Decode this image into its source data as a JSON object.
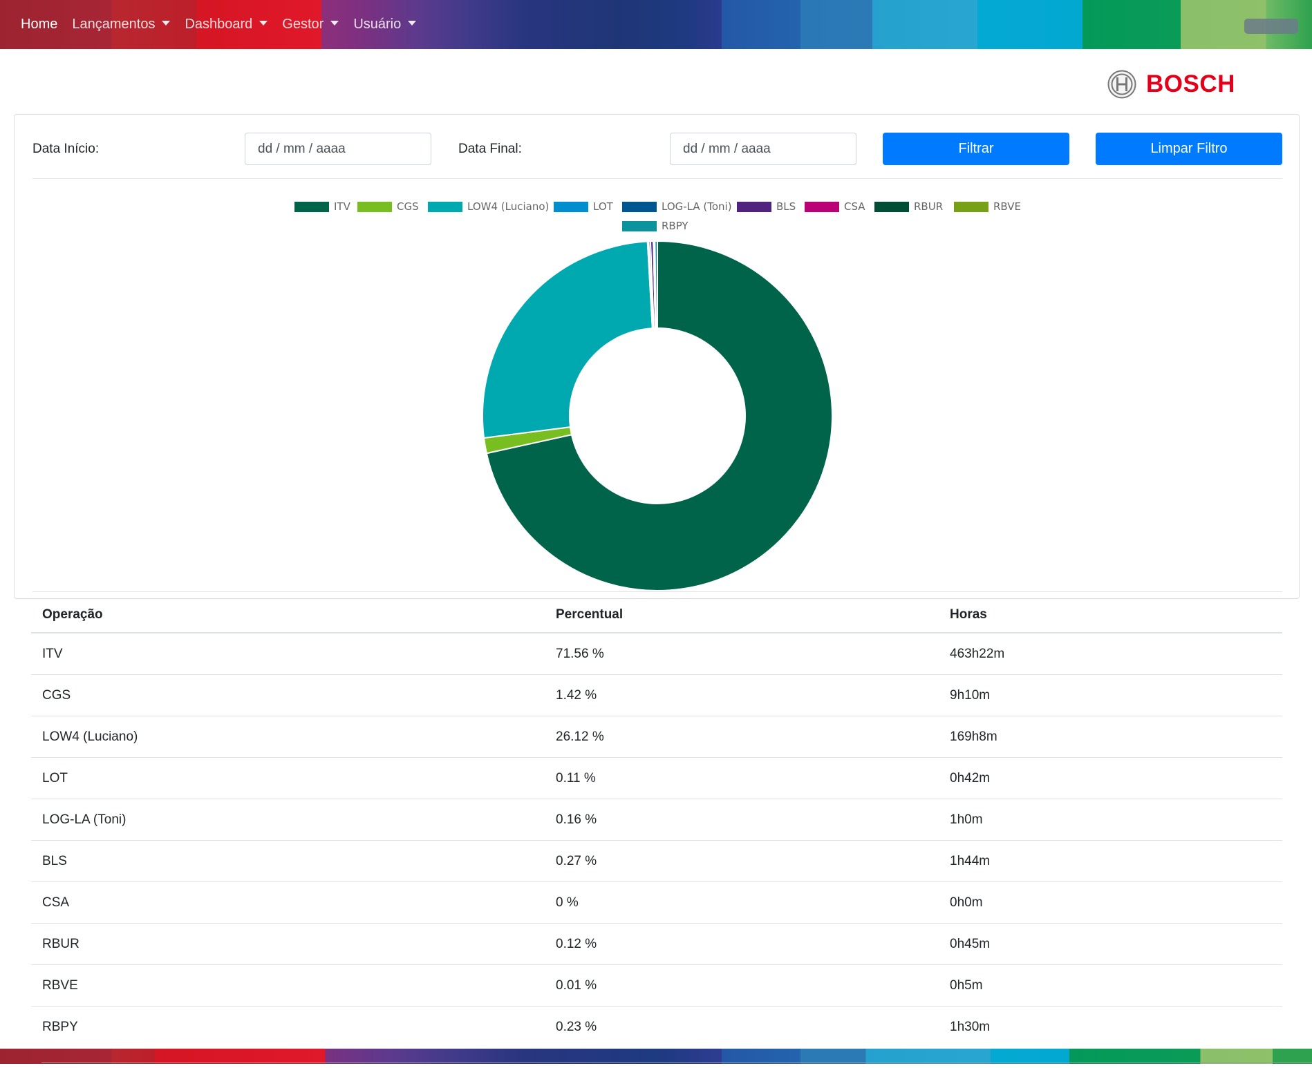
{
  "navbar": {
    "items": [
      {
        "label": "Home",
        "active": true,
        "dropdown": false
      },
      {
        "label": "Lançamentos",
        "active": false,
        "dropdown": true
      },
      {
        "label": "Dashboard",
        "active": false,
        "dropdown": true
      },
      {
        "label": "Gestor",
        "active": false,
        "dropdown": true
      },
      {
        "label": "Usuário",
        "active": false,
        "dropdown": true
      }
    ]
  },
  "brand": {
    "name": "BOSCH",
    "color": "#e2001a"
  },
  "filter": {
    "start_label": "Data Início:",
    "start_placeholder": "dd / mm / aaaa",
    "end_label": "Data Final:",
    "end_placeholder": "dd / mm / aaaa",
    "filter_button": "Filtrar",
    "clear_button": "Limpar Filtro",
    "button_color": "#007bff"
  },
  "chart_data": {
    "type": "doughnut",
    "legend_position": "top",
    "labels": [
      "ITV",
      "CGS",
      "LOW4 (Luciano)",
      "LOT",
      "LOG-LA (Toni)",
      "BLS",
      "CSA",
      "RBUR",
      "RBVE",
      "RBPY"
    ],
    "values": [
      71.56,
      1.42,
      26.12,
      0.11,
      0.16,
      0.27,
      0,
      0.12,
      0.01,
      0.23
    ],
    "colors": [
      "#00644b",
      "#78be20",
      "#00a8b0",
      "#008ecf",
      "#005691",
      "#50237f",
      "#b90276",
      "#004d36",
      "#78a016",
      "#0b949e"
    ]
  },
  "table": {
    "headers": [
      "Operação",
      "Percentual",
      "Horas"
    ],
    "rows": [
      [
        "ITV",
        "71.56 %",
        "463h22m"
      ],
      [
        "CGS",
        "1.42 %",
        "9h10m"
      ],
      [
        "LOW4 (Luciano)",
        "26.12 %",
        "169h8m"
      ],
      [
        "LOT",
        "0.11 %",
        "0h42m"
      ],
      [
        "LOG-LA (Toni)",
        "0.16 %",
        "1h0m"
      ],
      [
        "BLS",
        "0.27 %",
        "1h44m"
      ],
      [
        "CSA",
        "0 %",
        "0h0m"
      ],
      [
        "RBUR",
        "0.12 %",
        "0h45m"
      ],
      [
        "RBVE",
        "0.01 %",
        "0h5m"
      ],
      [
        "RBPY",
        "0.23 %",
        "1h30m"
      ]
    ]
  }
}
